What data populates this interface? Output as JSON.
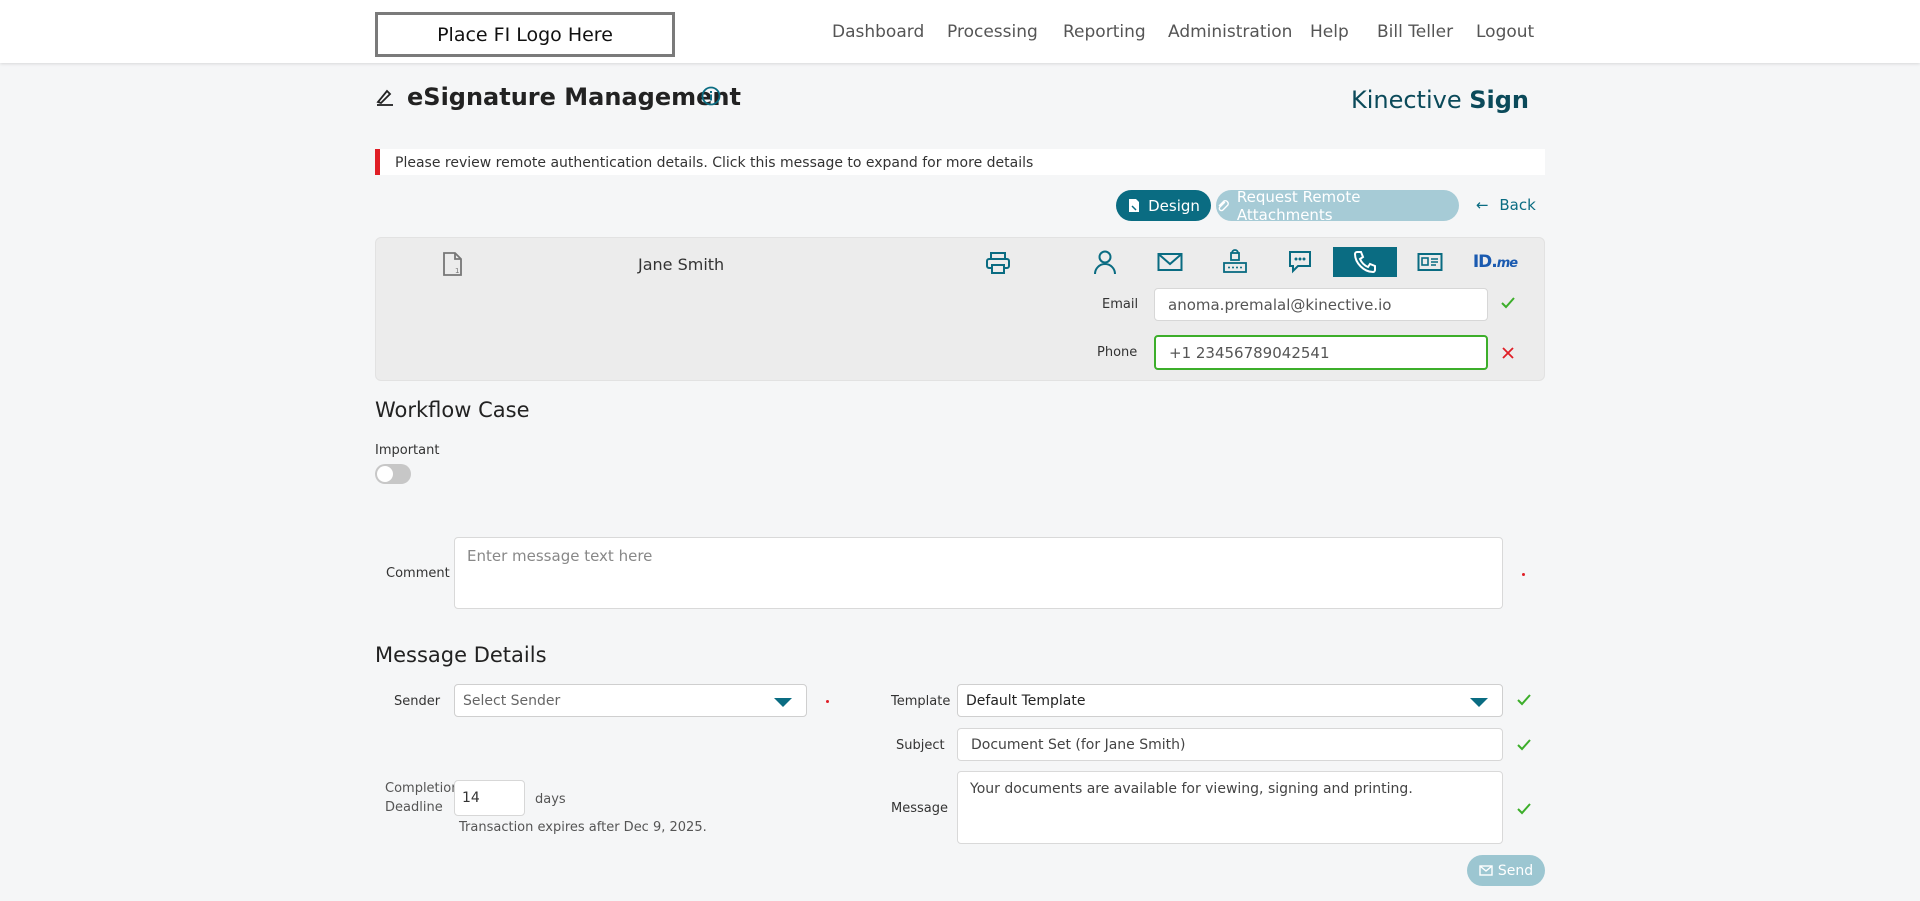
{
  "header": {
    "logo_text": "Place FI Logo Here",
    "nav": [
      "Dashboard",
      "Processing",
      "Reporting",
      "Administration",
      "Help",
      "Bill Teller",
      "Logout"
    ]
  },
  "page": {
    "title": "eSignature Management",
    "brand_light": "Kinective ",
    "brand_bold": "Sign",
    "alert": "Please review remote authentication details. Click this message to expand for more details"
  },
  "actions": {
    "design": "Design",
    "request_remote": "Request Remote Attachments",
    "back": "Back"
  },
  "signer": {
    "name": "Jane Smith",
    "email_label": "Email",
    "email_value": "anoma.premalal@kinective.io",
    "phone_label": "Phone",
    "phone_value": "+1 23456789042541",
    "active_method": "phone-icon",
    "methods": [
      "person-icon",
      "email-icon",
      "knowledge-icon",
      "sms-icon",
      "phone-icon",
      "id-card-icon",
      "idme-icon"
    ]
  },
  "workflow": {
    "title": "Workflow Case",
    "important_label": "Important",
    "comment_label": "Comment",
    "comment_placeholder": "Enter message text here"
  },
  "message": {
    "title": "Message Details",
    "sender_label": "Sender",
    "sender_placeholder": "Select Sender",
    "template_label": "Template",
    "template_value": "Default Template",
    "subject_label": "Subject",
    "subject_value": "Document Set (for Jane Smith)",
    "message_label": "Message",
    "message_value": "Your documents are available for viewing, signing and printing.",
    "deadline_label_1": "Completion",
    "deadline_label_2": "Deadline",
    "deadline_value": "14",
    "days_label": "days",
    "expires_note": "Transaction expires after Dec 9, 2025.",
    "send": "Send"
  },
  "colors": {
    "accent": "#0a6c82",
    "ok": "#3cae2a",
    "error": "#e01e26"
  }
}
